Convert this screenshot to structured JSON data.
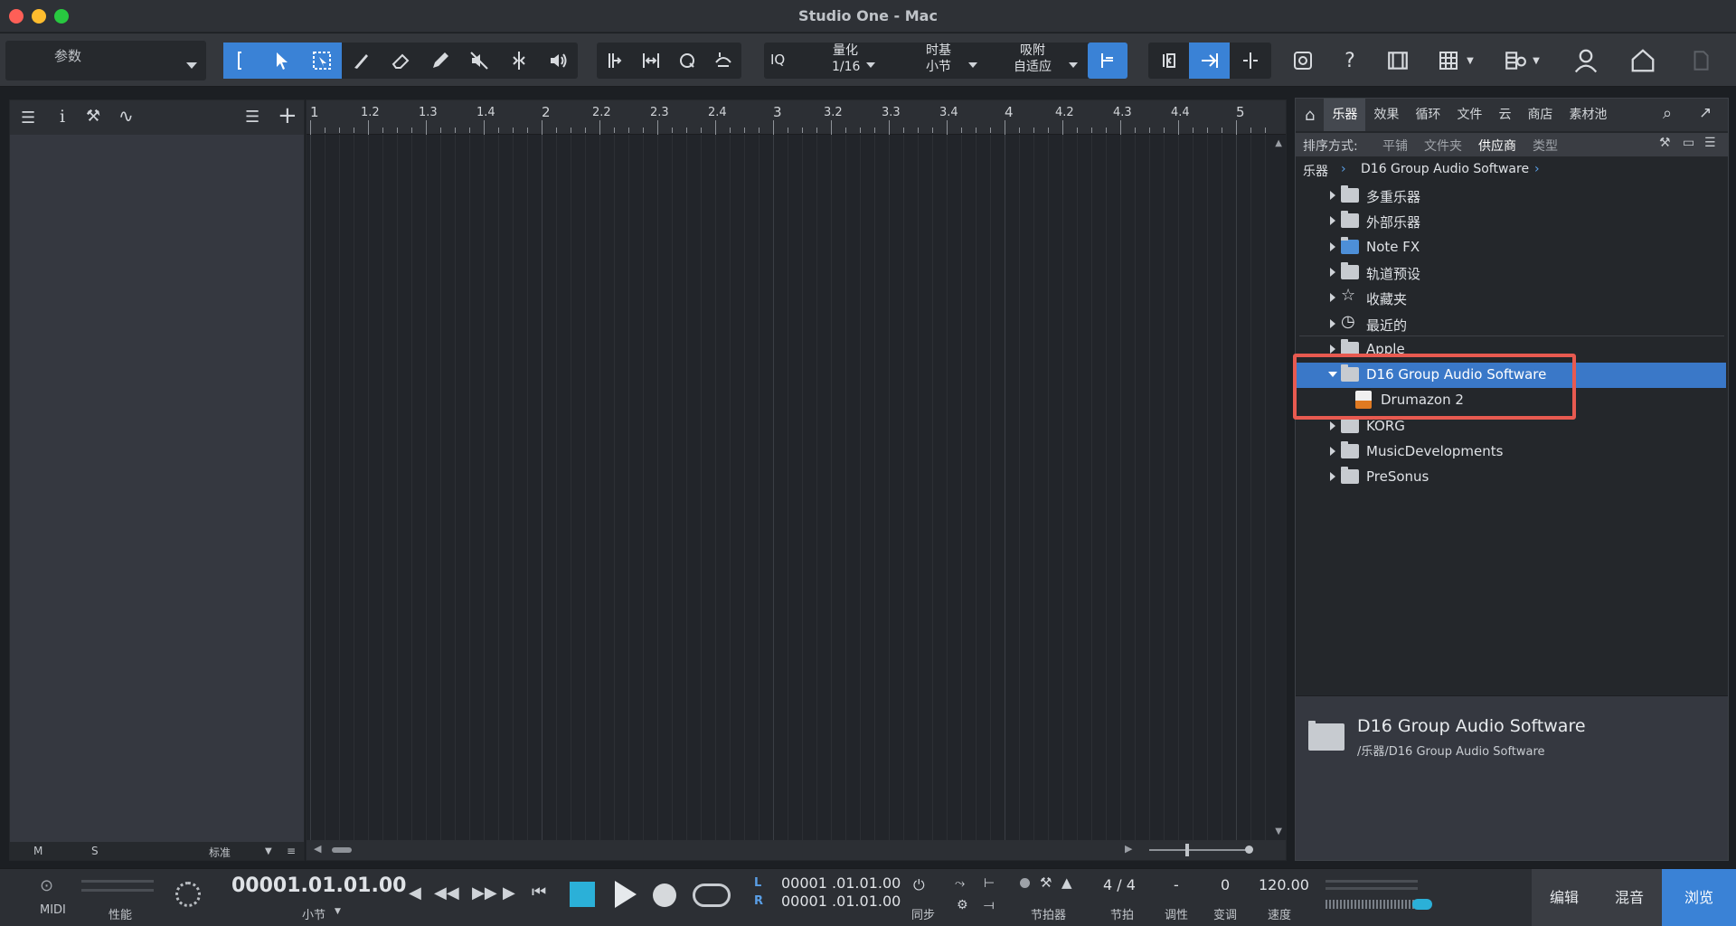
{
  "window": {
    "title": "Studio One - Mac"
  },
  "toolbar": {
    "param_label": "参数",
    "iq_label": "IQ",
    "quantize": {
      "label": "量化",
      "value": "1/16"
    },
    "timebase": {
      "label": "时基",
      "value": "小节"
    },
    "snap": {
      "label": "吸附",
      "value": "自适应"
    }
  },
  "ruler": {
    "labels": [
      "1",
      "1.2",
      "1.3",
      "1.4",
      "2",
      "2.2",
      "2.3",
      "2.4",
      "3",
      "3.2",
      "3.3",
      "3.4",
      "4",
      "4.2",
      "4.3",
      "4.4",
      "5"
    ]
  },
  "left_panel": {
    "footer": {
      "m": "M",
      "s": "S",
      "mode": "标准"
    }
  },
  "browser": {
    "tabs": [
      "乐器",
      "效果",
      "循环",
      "文件",
      "云",
      "商店",
      "素材池"
    ],
    "active_tab": "乐器",
    "sort": {
      "label": "排序方式:",
      "options": [
        "平铺",
        "文件夹",
        "供应商",
        "类型"
      ],
      "active": "供应商"
    },
    "breadcrumb": [
      "乐器",
      "D16 Group Audio Software"
    ],
    "tree": [
      {
        "label": "多重乐器",
        "icon": "multi-instrument-icon"
      },
      {
        "label": "外部乐器",
        "icon": "external-instrument-icon"
      },
      {
        "label": "Note FX",
        "icon": "notefx-folder-icon"
      },
      {
        "label": "轨道预设",
        "icon": "track-preset-icon"
      },
      {
        "label": "收藏夹",
        "icon": "star-icon"
      },
      {
        "label": "最近的",
        "icon": "clock-icon"
      },
      {
        "label": "Apple",
        "icon": "folder-icon"
      },
      {
        "label": "D16 Group Audio Software",
        "icon": "open-folder-icon",
        "expanded": true,
        "selected": true
      },
      {
        "label": "Drumazon 2",
        "icon": "au-plugin-icon",
        "child": true
      },
      {
        "label": "KORG",
        "icon": "folder-icon"
      },
      {
        "label": "MusicDevelopments",
        "icon": "folder-icon"
      },
      {
        "label": "PreSonus",
        "icon": "presonus-icon"
      }
    ],
    "info": {
      "title": "D16 Group Audio Software",
      "path": "/乐器/D16 Group Audio Software"
    },
    "highlight_color": "#e85a50",
    "selected_color": "#3a78c8"
  },
  "transport": {
    "midi_label": "MIDI",
    "perf_label": "性能",
    "position": "00001.01.01.00",
    "position_unit": "小节",
    "loop_l": "00001 .01.01.00",
    "loop_r": "00001 .01.01.00",
    "sync_label": "同步",
    "metronome_label": "节拍器",
    "time_sig": "4 / 4",
    "time_sig_label": "节拍",
    "key": "-",
    "key_label": "调性",
    "transpose": "0",
    "transpose_label": "变调",
    "tempo": "120.00",
    "tempo_label": "速度",
    "modes": [
      "编辑",
      "混音",
      "浏览"
    ],
    "active_mode": "浏览",
    "accent_color": "#3a82d6"
  }
}
